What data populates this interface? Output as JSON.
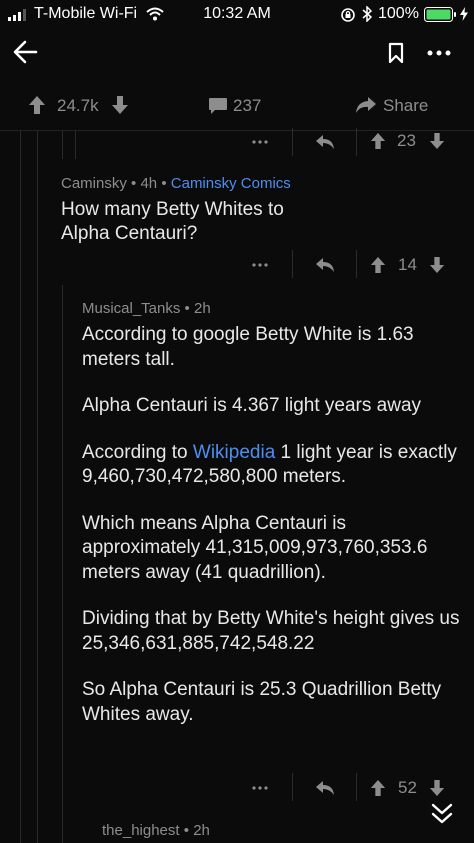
{
  "status_bar": {
    "carrier": "T-Mobile Wi-Fi",
    "time": "10:32 AM",
    "battery": "100%"
  },
  "post_bar": {
    "votes": "24.7k",
    "comments": "237",
    "share_label": "Share"
  },
  "comments": [
    {
      "votes": "23"
    },
    {
      "author": "Caminsky",
      "age": "4h",
      "flair": "Caminsky Comics",
      "body": [
        "How many Betty Whites to Alpha Centauri?"
      ],
      "votes": "14"
    },
    {
      "author": "Musical_Tanks",
      "age": "2h",
      "paragraphs": [
        {
          "text": "According to google Betty White is 1.63 meters tall."
        },
        {
          "text": "Alpha Centauri is 4.367 light years away"
        },
        {
          "prefix": "According to ",
          "link": "Wikipedia",
          "suffix": " 1 light year is exactly 9,460,730,472,580,800 meters."
        },
        {
          "text": "Which means Alpha Centauri is approximately 41,315,009,973,760,353.6 meters away (41 quadrillion)."
        },
        {
          "text": "Dividing that by Betty White's height gives us 25,346,631,885,742,548.22"
        },
        {
          "text": "So Alpha Centauri is 25.3 Quadrillion Betty Whites away."
        }
      ],
      "votes": "52"
    },
    {
      "author": "the_highest",
      "age": "2h"
    }
  ],
  "meta_separator": "•",
  "colors": {
    "background": "#0b0b0b",
    "text": "#e8e8e8",
    "muted": "#8d8d8d",
    "link": "#4d8ef0"
  }
}
